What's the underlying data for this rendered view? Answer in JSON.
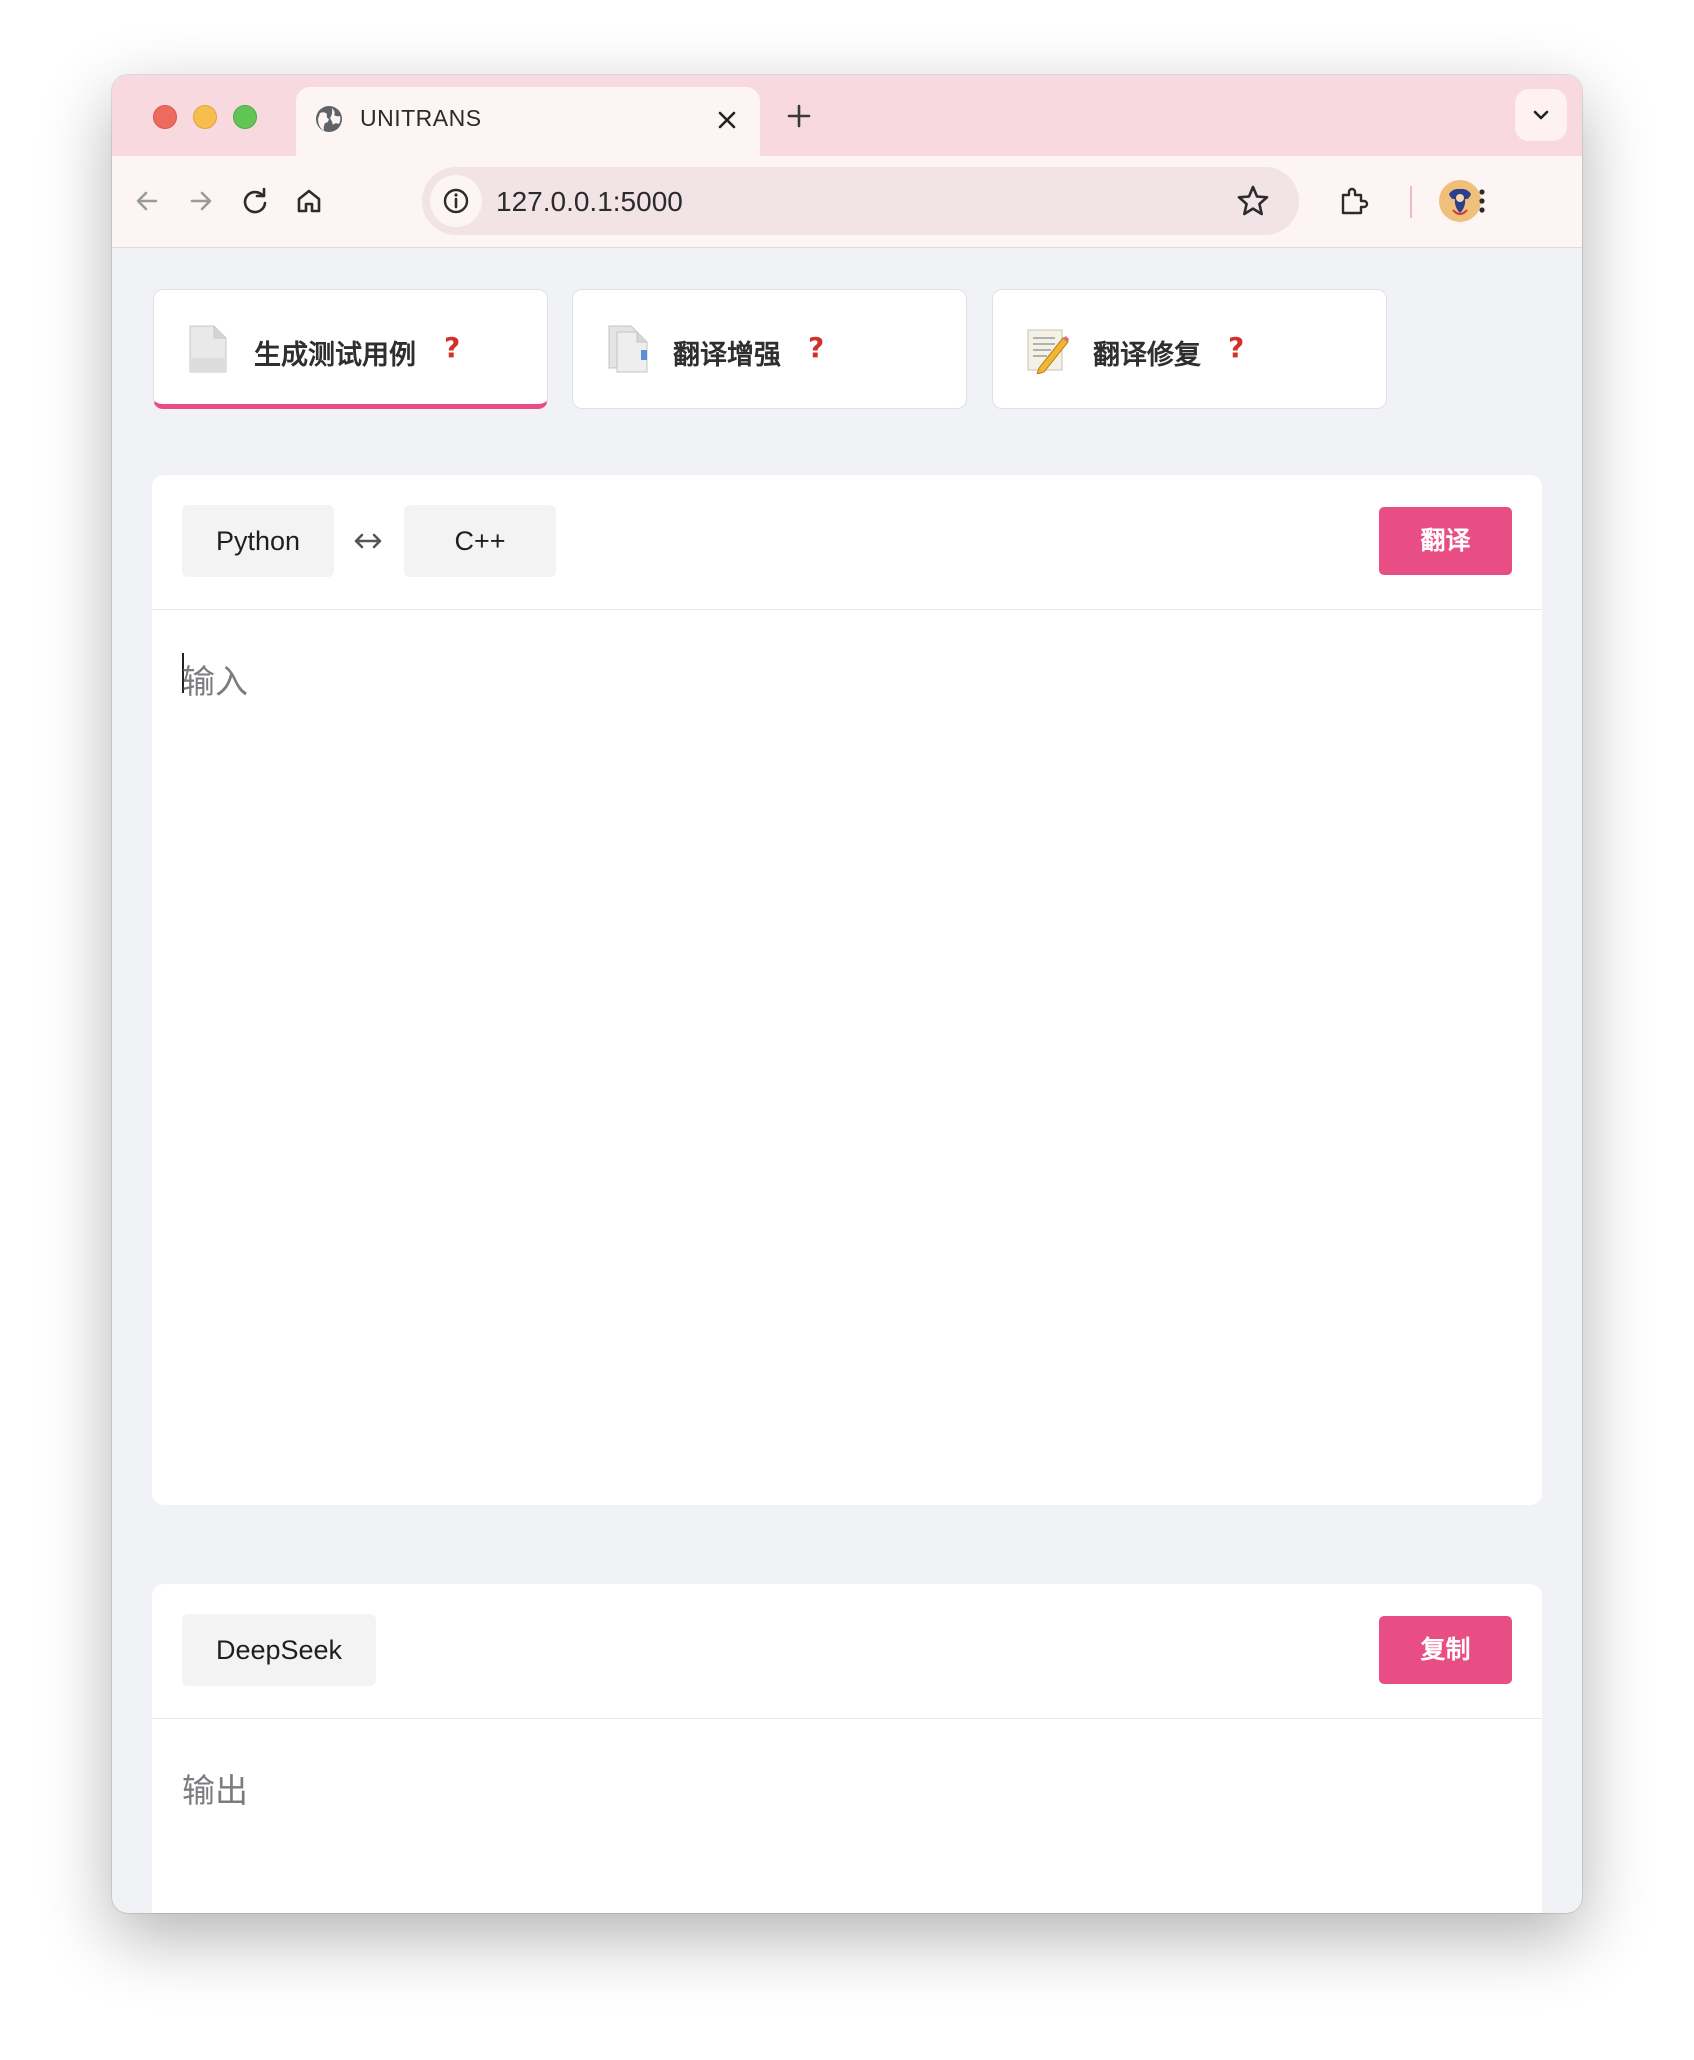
{
  "browser": {
    "tab_title": "UNITRANS",
    "url": "127.0.0.1:5000"
  },
  "modules": [
    {
      "label": "生成测试用例",
      "help": "?",
      "icon": "document-icon",
      "active": true
    },
    {
      "label": "翻译增强",
      "help": "?",
      "icon": "documents-icon",
      "active": false
    },
    {
      "label": "翻译修复",
      "help": "?",
      "icon": "notepad-pencil-icon",
      "active": false
    }
  ],
  "input_panel": {
    "source_language": "Python",
    "swap_symbol": "↔",
    "target_language": "C++",
    "translate_button": "翻译",
    "placeholder": "输入"
  },
  "output_panel": {
    "model": "DeepSeek",
    "copy_button": "复制",
    "placeholder": "输出"
  },
  "colors": {
    "accent": "#e84e84",
    "help": "#d2302e",
    "tab_strip": "#f7d9df",
    "page_background": "#f1f2f6"
  }
}
